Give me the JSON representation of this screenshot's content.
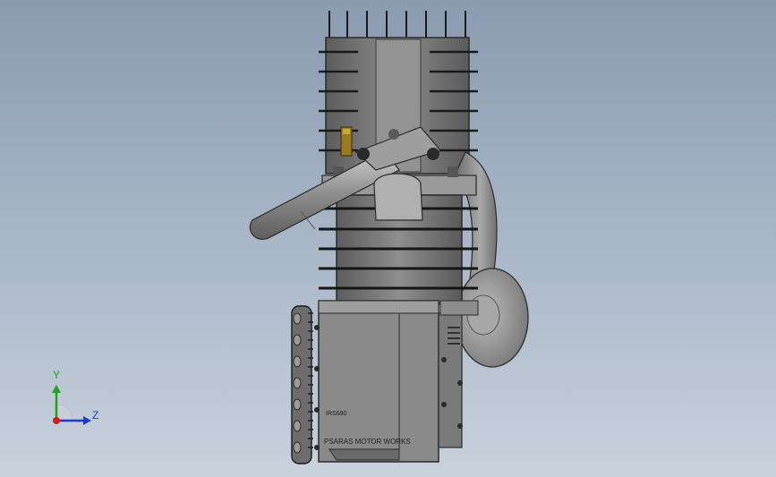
{
  "viewport": {
    "background_top": "#8a9bb0",
    "background_bottom": "#c9d1dc"
  },
  "model": {
    "part_color": "#7b7b7b",
    "dark_color": "#2a2a2a",
    "brass_color": "#9a7a1e",
    "crankcase_engraving_1": "IRS680",
    "crankcase_engraving_2": "PSARAS MOTOR WORKS"
  },
  "triad": {
    "y_label": "Y",
    "z_label": "Z",
    "y_color": "#1ea01e",
    "z_color": "#1e3ad0",
    "x_color": "#d01e1e"
  }
}
